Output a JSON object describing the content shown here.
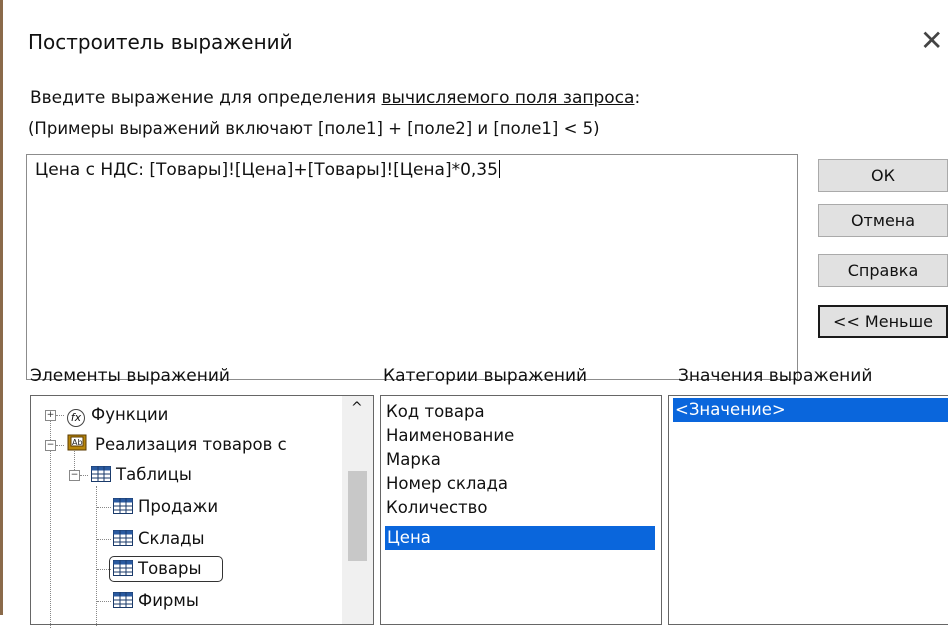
{
  "dialog": {
    "title": "Построитель выражений",
    "close_glyph": "✕",
    "instruction_pre": "Введите выражение для определения ",
    "instruction_link": "вычисляемого поля запроса",
    "instruction_post": ":",
    "example": "(Примеры выражений включают [поле1] + [поле2] и [поле1] < 5)"
  },
  "expression": {
    "value": "Цена с НДС: [Товары]![Цена]+[Товары]![Цена]*0,35"
  },
  "buttons": {
    "ok": "ОК",
    "cancel": "Отмена",
    "help": "Справка",
    "less": "<< Меньше"
  },
  "panels": {
    "elements_label": "Элементы выражений",
    "categories_label": "Категории выражений",
    "values_label": "Значения выражений"
  },
  "tree": {
    "functions": "Функции",
    "database": "Реализация товаров с",
    "tables": "Таблицы",
    "items": [
      "Продажи",
      "Склады",
      "Товары",
      "Фирмы"
    ],
    "selected_item": "Товары",
    "expander_plus": "+",
    "expander_minus": "−",
    "scroll_up_glyph": "^"
  },
  "categories": {
    "items": [
      "Код товара",
      "Наименование",
      "Марка",
      "Номер склада",
      "Количество"
    ],
    "selected": "Цена"
  },
  "values": {
    "selected": "<Значение>"
  },
  "icons": {
    "function": "fx",
    "database": "Ab"
  },
  "colors": {
    "selection": "#0a66dc",
    "button_bg": "#e1e1e1"
  }
}
